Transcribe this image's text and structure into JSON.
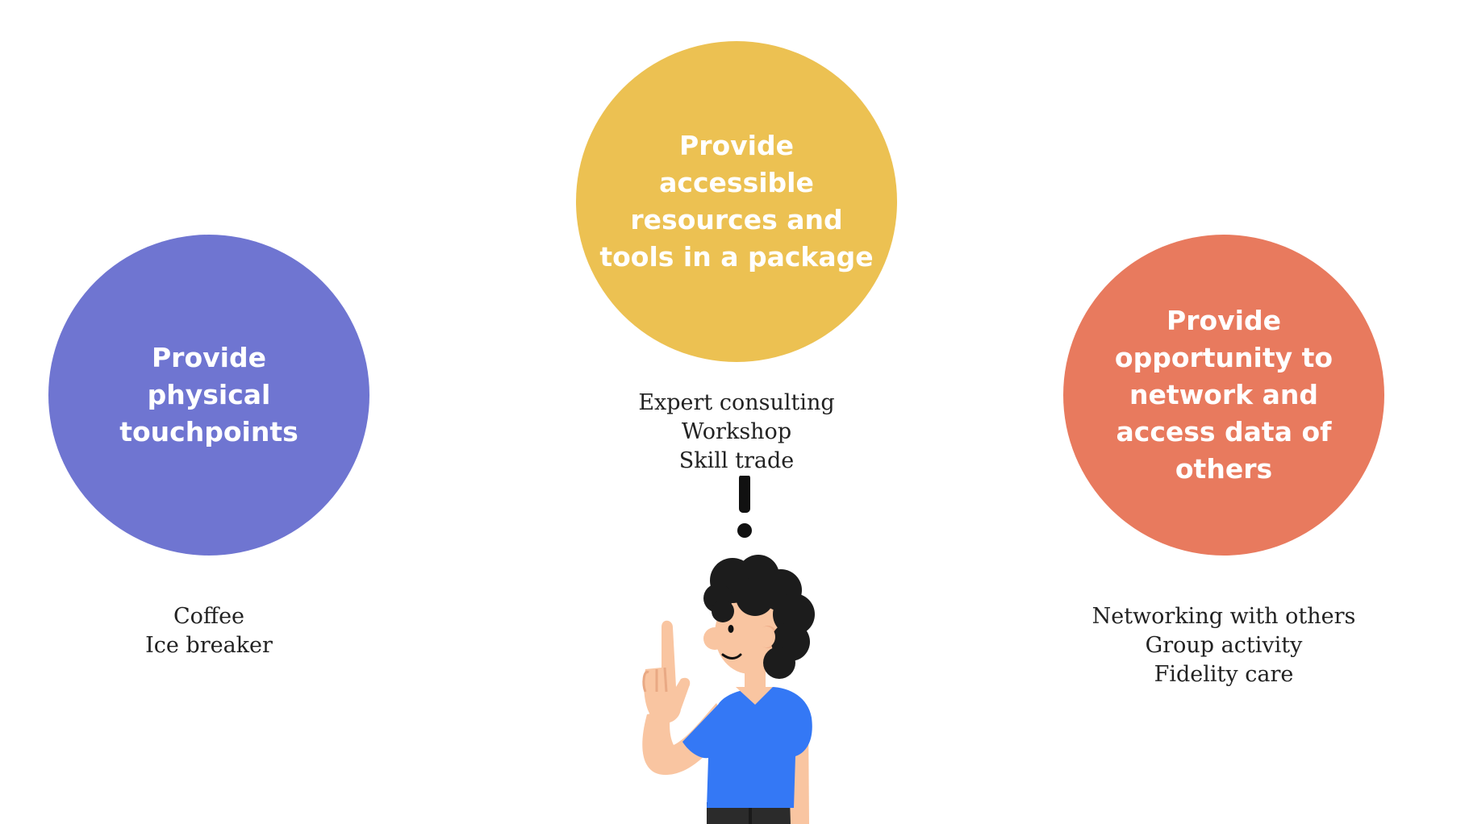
{
  "colors": {
    "left_circle": "#6f75d1",
    "center_circle": "#ecc152",
    "right_circle": "#e87a5e",
    "circle_text": "#ffffff",
    "note_text": "#222222"
  },
  "circles": [
    {
      "lines": [
        "Provide",
        "physical",
        "touchpoints"
      ],
      "notes": [
        "Coffee",
        "Ice breaker"
      ]
    },
    {
      "lines": [
        "Provide",
        "accessible",
        "resources and",
        "tools in a package"
      ],
      "notes": [
        "Expert consulting",
        "Workshop",
        "Skill trade"
      ]
    },
    {
      "lines": [
        "Provide",
        "opportunity to",
        "network and",
        "access data of",
        "others"
      ],
      "notes": [
        "Networking with others",
        "Group activity",
        "Fidelity care"
      ]
    }
  ],
  "illustration": {
    "icon": "person-idea-icon",
    "exclamation": "!"
  }
}
